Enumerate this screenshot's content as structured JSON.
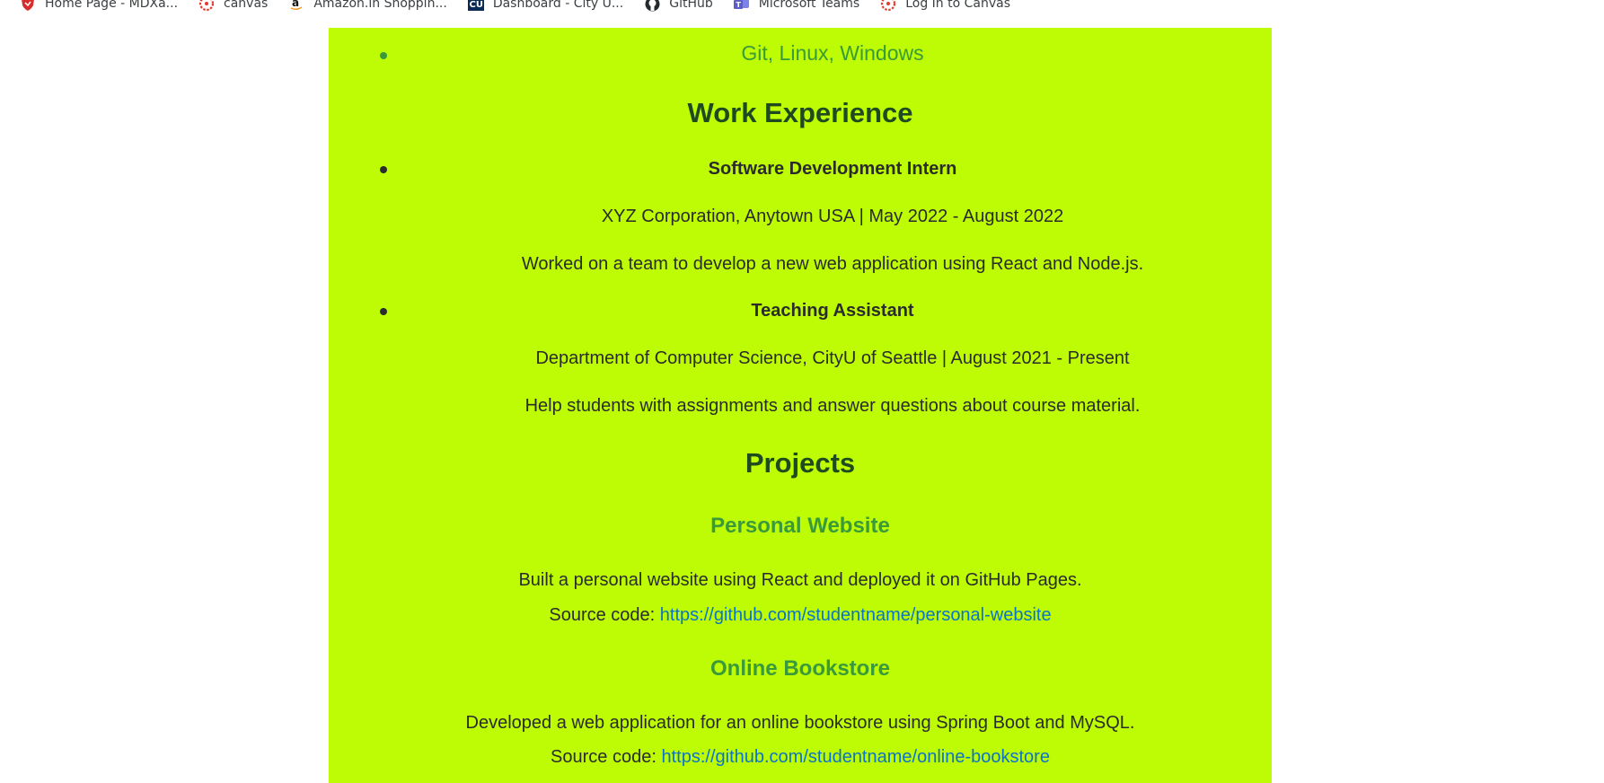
{
  "bookmarks": [
    {
      "label": "Home Page - MDXa...",
      "icon": "shield-icon",
      "color": "#d62d2d"
    },
    {
      "label": "canvas",
      "icon": "canvas-icon",
      "color": "#e13b2f"
    },
    {
      "label": "Amazon.in Shoppin...",
      "icon": "amazon-icon",
      "color": "#111111"
    },
    {
      "label": "Dashboard - City U...",
      "icon": "cu-icon",
      "color": "#0a2a56"
    },
    {
      "label": "GitHub",
      "icon": "github-icon",
      "color": "#24292f"
    },
    {
      "label": "Microsoft Teams",
      "icon": "teams-icon",
      "color": "#5b5fc7"
    },
    {
      "label": "Log In to Canvas",
      "icon": "canvas-icon",
      "color": "#e13b2f"
    }
  ],
  "skills": {
    "last_item": "Git, Linux, Windows"
  },
  "work": {
    "heading": "Work Experience",
    "jobs": [
      {
        "title": "Software Development Intern",
        "meta": "XYZ Corporation, Anytown USA | May 2022 - August 2022",
        "desc": "Worked on a team to develop a new web application using React and Node.js."
      },
      {
        "title": "Teaching Assistant",
        "meta": "Department of Computer Science, CityU of Seattle | August 2021 - Present",
        "desc": "Help students with assignments and answer questions about course material."
      }
    ]
  },
  "projects": {
    "heading": "Projects",
    "items": [
      {
        "name": "Personal Website",
        "desc": "Built a personal website using React and deployed it on GitHub Pages.",
        "source_label": "Source code: ",
        "url": "https://github.com/studentname/personal-website"
      },
      {
        "name": "Online Bookstore",
        "desc": "Developed a web application for an online bookstore using Spring Boot and MySQL.",
        "source_label": "Source code: ",
        "url": "https://github.com/studentname/online-bookstore"
      }
    ]
  },
  "colors": {
    "panel_bg": "#bdfc04",
    "accent_green": "#3a9a3a",
    "link_blue": "#0b74c9"
  }
}
